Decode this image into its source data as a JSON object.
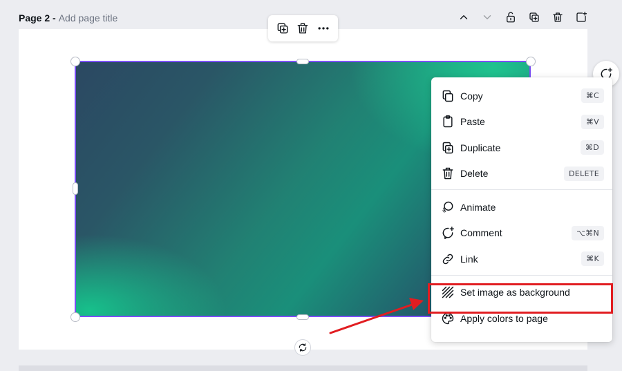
{
  "page_header": {
    "page_number": "Page 2 -",
    "title_placeholder": "Add page title"
  },
  "page_controls": [
    {
      "name": "move-up-icon"
    },
    {
      "name": "move-down-icon"
    },
    {
      "name": "lock-icon"
    },
    {
      "name": "duplicate-page-icon"
    },
    {
      "name": "delete-page-icon"
    },
    {
      "name": "add-page-icon"
    }
  ],
  "float_toolbar": {
    "items": [
      "duplicate-icon",
      "trash-icon",
      "more-icon"
    ]
  },
  "context_menu": {
    "groups": [
      [
        {
          "icon": "copy-icon",
          "label": "Copy",
          "shortcut": "⌘C"
        },
        {
          "icon": "paste-icon",
          "label": "Paste",
          "shortcut": "⌘V"
        },
        {
          "icon": "duplicate-icon",
          "label": "Duplicate",
          "shortcut": "⌘D"
        },
        {
          "icon": "trash-icon",
          "label": "Delete",
          "shortcut": "DELETE"
        }
      ],
      [
        {
          "icon": "animate-icon",
          "label": "Animate",
          "shortcut": ""
        },
        {
          "icon": "comment-icon",
          "label": "Comment",
          "shortcut": "⌥⌘N"
        },
        {
          "icon": "link-icon",
          "label": "Link",
          "shortcut": "⌘K"
        }
      ],
      [
        {
          "icon": "set-background-icon",
          "label": "Set image as background",
          "shortcut": ""
        },
        {
          "icon": "palette-icon",
          "label": "Apply colors to page",
          "shortcut": ""
        }
      ]
    ]
  },
  "colors": {
    "selection": "#7b4ff5",
    "annotation": "#e11d21",
    "canvas_bg": "#ecedf1"
  }
}
